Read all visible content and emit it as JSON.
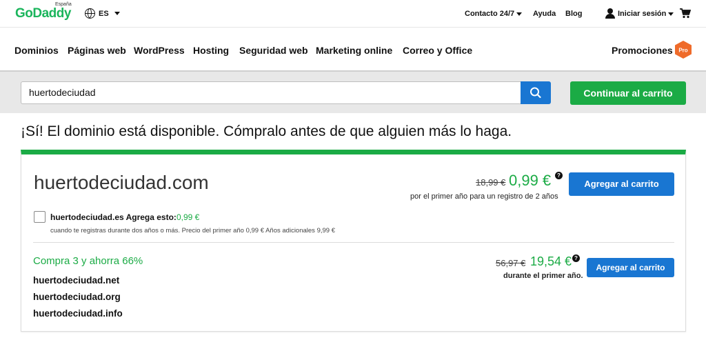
{
  "topbar": {
    "logo": "GoDaddy",
    "logo_region": "España",
    "language": "ES",
    "contact": "Contacto 24/7",
    "help": "Ayuda",
    "blog": "Blog",
    "signin": "Iniciar sesión"
  },
  "nav": {
    "items": [
      "Dominios",
      "Páginas web",
      "WordPress",
      "Hosting",
      "Seguridad web",
      "Marketing online",
      "Correo y Office"
    ],
    "promotions": "Promociones",
    "pro_badge": "Pro"
  },
  "search": {
    "value": "huertodeciudad",
    "continue_label": "Continuar al carrito"
  },
  "headline": "¡Sí! El dominio está disponible. Cómpralo antes de que alguien más lo haga.",
  "result": {
    "domain": "huertodeciudad.com",
    "old_price": "18,99 €",
    "new_price": "0,99 €",
    "price_note": "por el primer año para un registro de 2 años",
    "add_label": "Agregar al carrito",
    "addon_domain": "huertodeciudad.es",
    "addon_label": "Agrega esto:",
    "addon_price": "0,99 €",
    "addon_note": "cuando te registras durante dos años o más. Precio del primer año 0,99 € Años adicionales 9,99 €"
  },
  "bundle": {
    "title": "Compra 3 y ahorra 66%",
    "domains": [
      "huertodeciudad.net",
      "huertodeciudad.org",
      "huertodeciudad.info"
    ],
    "old_price": "56,97 €",
    "new_price": "19,54 €",
    "price_note": "durante el primer año.",
    "add_label": "Agregar al carrito"
  },
  "colors": {
    "brand_green": "#1bab45",
    "action_blue": "#1976d2",
    "pro_orange": "#ef6b2a"
  },
  "icons": [
    "globe-icon",
    "user-icon",
    "cart-icon",
    "search-icon",
    "help-icon"
  ]
}
